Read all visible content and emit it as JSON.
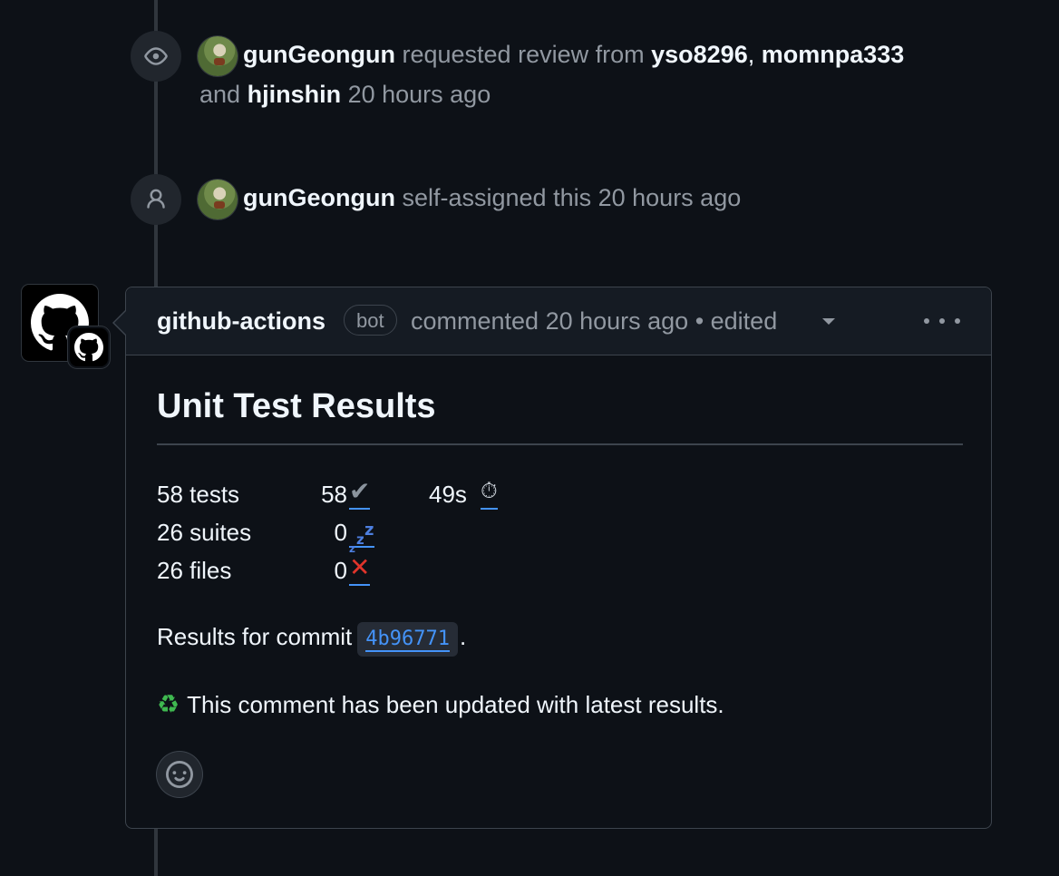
{
  "timeline": {
    "review_request": {
      "actor": "gunGeongun",
      "action": "requested review from",
      "reviewers": [
        "yso8296",
        "momnpa333",
        "hjinshin"
      ],
      "separator": ",",
      "conjunction": "and",
      "time": "20 hours ago"
    },
    "self_assign": {
      "actor": "gunGeongun",
      "action": "self-assigned this",
      "time": "20 hours ago"
    }
  },
  "comment": {
    "author": "github-actions",
    "bot_label": "bot",
    "meta": "commented 20 hours ago • edited",
    "title": "Unit Test Results",
    "stats": [
      {
        "label": "58 tests",
        "num": "58",
        "icon": "✔"
      },
      {
        "label": "26 suites",
        "num": "0",
        "icon": "💤"
      },
      {
        "label": "26 files",
        "num": "0",
        "icon": "❌"
      }
    ],
    "duration": "49s",
    "duration_icon": "⏱",
    "commit_prefix": "Results for commit",
    "commit_hash": "4b96771",
    "commit_suffix": ".",
    "update_icon": "♻",
    "update_text": "This comment has been updated with latest results."
  },
  "icons": {
    "review": "eye-icon",
    "assign": "person-icon",
    "more": "kebab-horizontal-icon",
    "reaction": "smiley-icon"
  },
  "colors": {
    "background": "#0d1117",
    "link": "#4493f8",
    "muted": "#9198a1"
  }
}
